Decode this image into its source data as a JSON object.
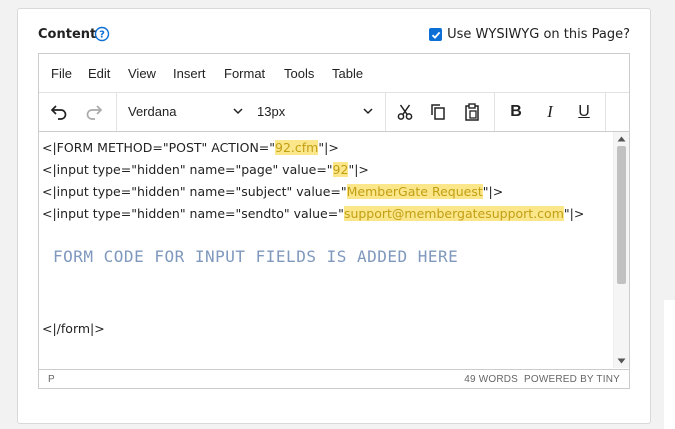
{
  "header": {
    "content_label": "Content",
    "help_icon": "question-circle-icon",
    "wysiwyg_label": "Use WYSIWYG on this Page?",
    "wysiwyg_checked": true
  },
  "menubar": {
    "items": [
      "File",
      "Edit",
      "View",
      "Insert",
      "Format",
      "Tools",
      "Table"
    ]
  },
  "toolbar": {
    "undo_icon": "undo-icon",
    "redo_icon": "redo-icon",
    "font_family": "Verdana",
    "font_size": "13px",
    "cut_icon": "scissors-icon",
    "copy_icon": "copy-icon",
    "paste_icon": "paste-icon",
    "bold_label": "B",
    "italic_label": "I",
    "underline_label": "U"
  },
  "editor": {
    "lines": {
      "l1": {
        "pre": "<|FORM METHOD=\"POST\" ACTION=\"",
        "hl": "92.cfm",
        "post": "\"|>"
      },
      "l2": {
        "pre": "<|input type=\"hidden\" name=\"page\" value=\"",
        "hl": "92",
        "post": "\"|>"
      },
      "l3": {
        "pre": "<|input type=\"hidden\" name=\"subject\" value=\"",
        "hl": "MemberGate Request",
        "post": "\"|>"
      },
      "l4": {
        "pre": "<|input type=\"hidden\" name=\"sendto\" value=\"",
        "hl": "support@membergatesupport.com",
        "post": "\"|>"
      },
      "l5": {
        "text": "<|/form|>"
      }
    },
    "placeholder": "FORM CODE FOR INPUT FIELDS IS ADDED HERE"
  },
  "statusbar": {
    "path": "P",
    "word_count": "49 WORDS",
    "powered_by": "POWERED BY TINY"
  },
  "colors": {
    "highlight_bg": "#fbe68a",
    "highlight_text": "#c29f13",
    "placeholder_text": "#7f98bd",
    "accent": "#0b6fd6"
  }
}
